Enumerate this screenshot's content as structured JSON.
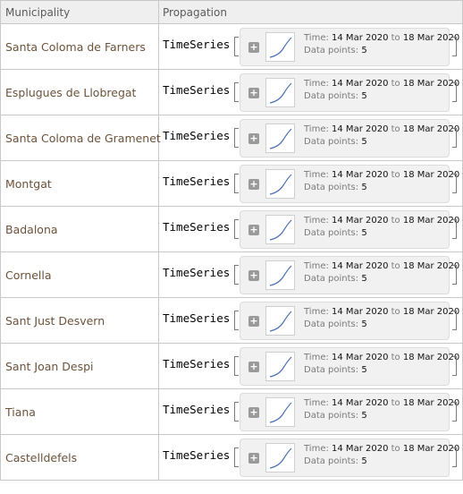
{
  "header": {
    "col_municipality": "Municipality",
    "col_propagation": "Propagation"
  },
  "labels": {
    "ts_head": "TimeSeries",
    "time": "Time:",
    "to": "to",
    "points": "Data points:"
  },
  "colors": {
    "municipality_text": "#6b5239",
    "sparkline": "#4a6fb5"
  },
  "rows": [
    {
      "municipality": "Santa Coloma de Farners",
      "from": "14 Mar 2020",
      "to": "18 Mar 2020",
      "points": "5"
    },
    {
      "municipality": "Esplugues de Llobregat",
      "from": "14 Mar 2020",
      "to": "18 Mar 2020",
      "points": "5"
    },
    {
      "municipality": "Santa Coloma de Gramenet",
      "from": "14 Mar 2020",
      "to": "18 Mar 2020",
      "points": "5"
    },
    {
      "municipality": "Montgat",
      "from": "14 Mar 2020",
      "to": "18 Mar 2020",
      "points": "5"
    },
    {
      "municipality": "Badalona",
      "from": "14 Mar 2020",
      "to": "18 Mar 2020",
      "points": "5"
    },
    {
      "municipality": "Cornella",
      "from": "14 Mar 2020",
      "to": "18 Mar 2020",
      "points": "5"
    },
    {
      "municipality": "Sant Just Desvern",
      "from": "14 Mar 2020",
      "to": "18 Mar 2020",
      "points": "5"
    },
    {
      "municipality": "Sant Joan Despi",
      "from": "14 Mar 2020",
      "to": "18 Mar 2020",
      "points": "5"
    },
    {
      "municipality": "Tiana",
      "from": "14 Mar 2020",
      "to": "18 Mar 2020",
      "points": "5"
    },
    {
      "municipality": "Castelldefels",
      "from": "14 Mar 2020",
      "to": "18 Mar 2020",
      "points": "5"
    }
  ]
}
